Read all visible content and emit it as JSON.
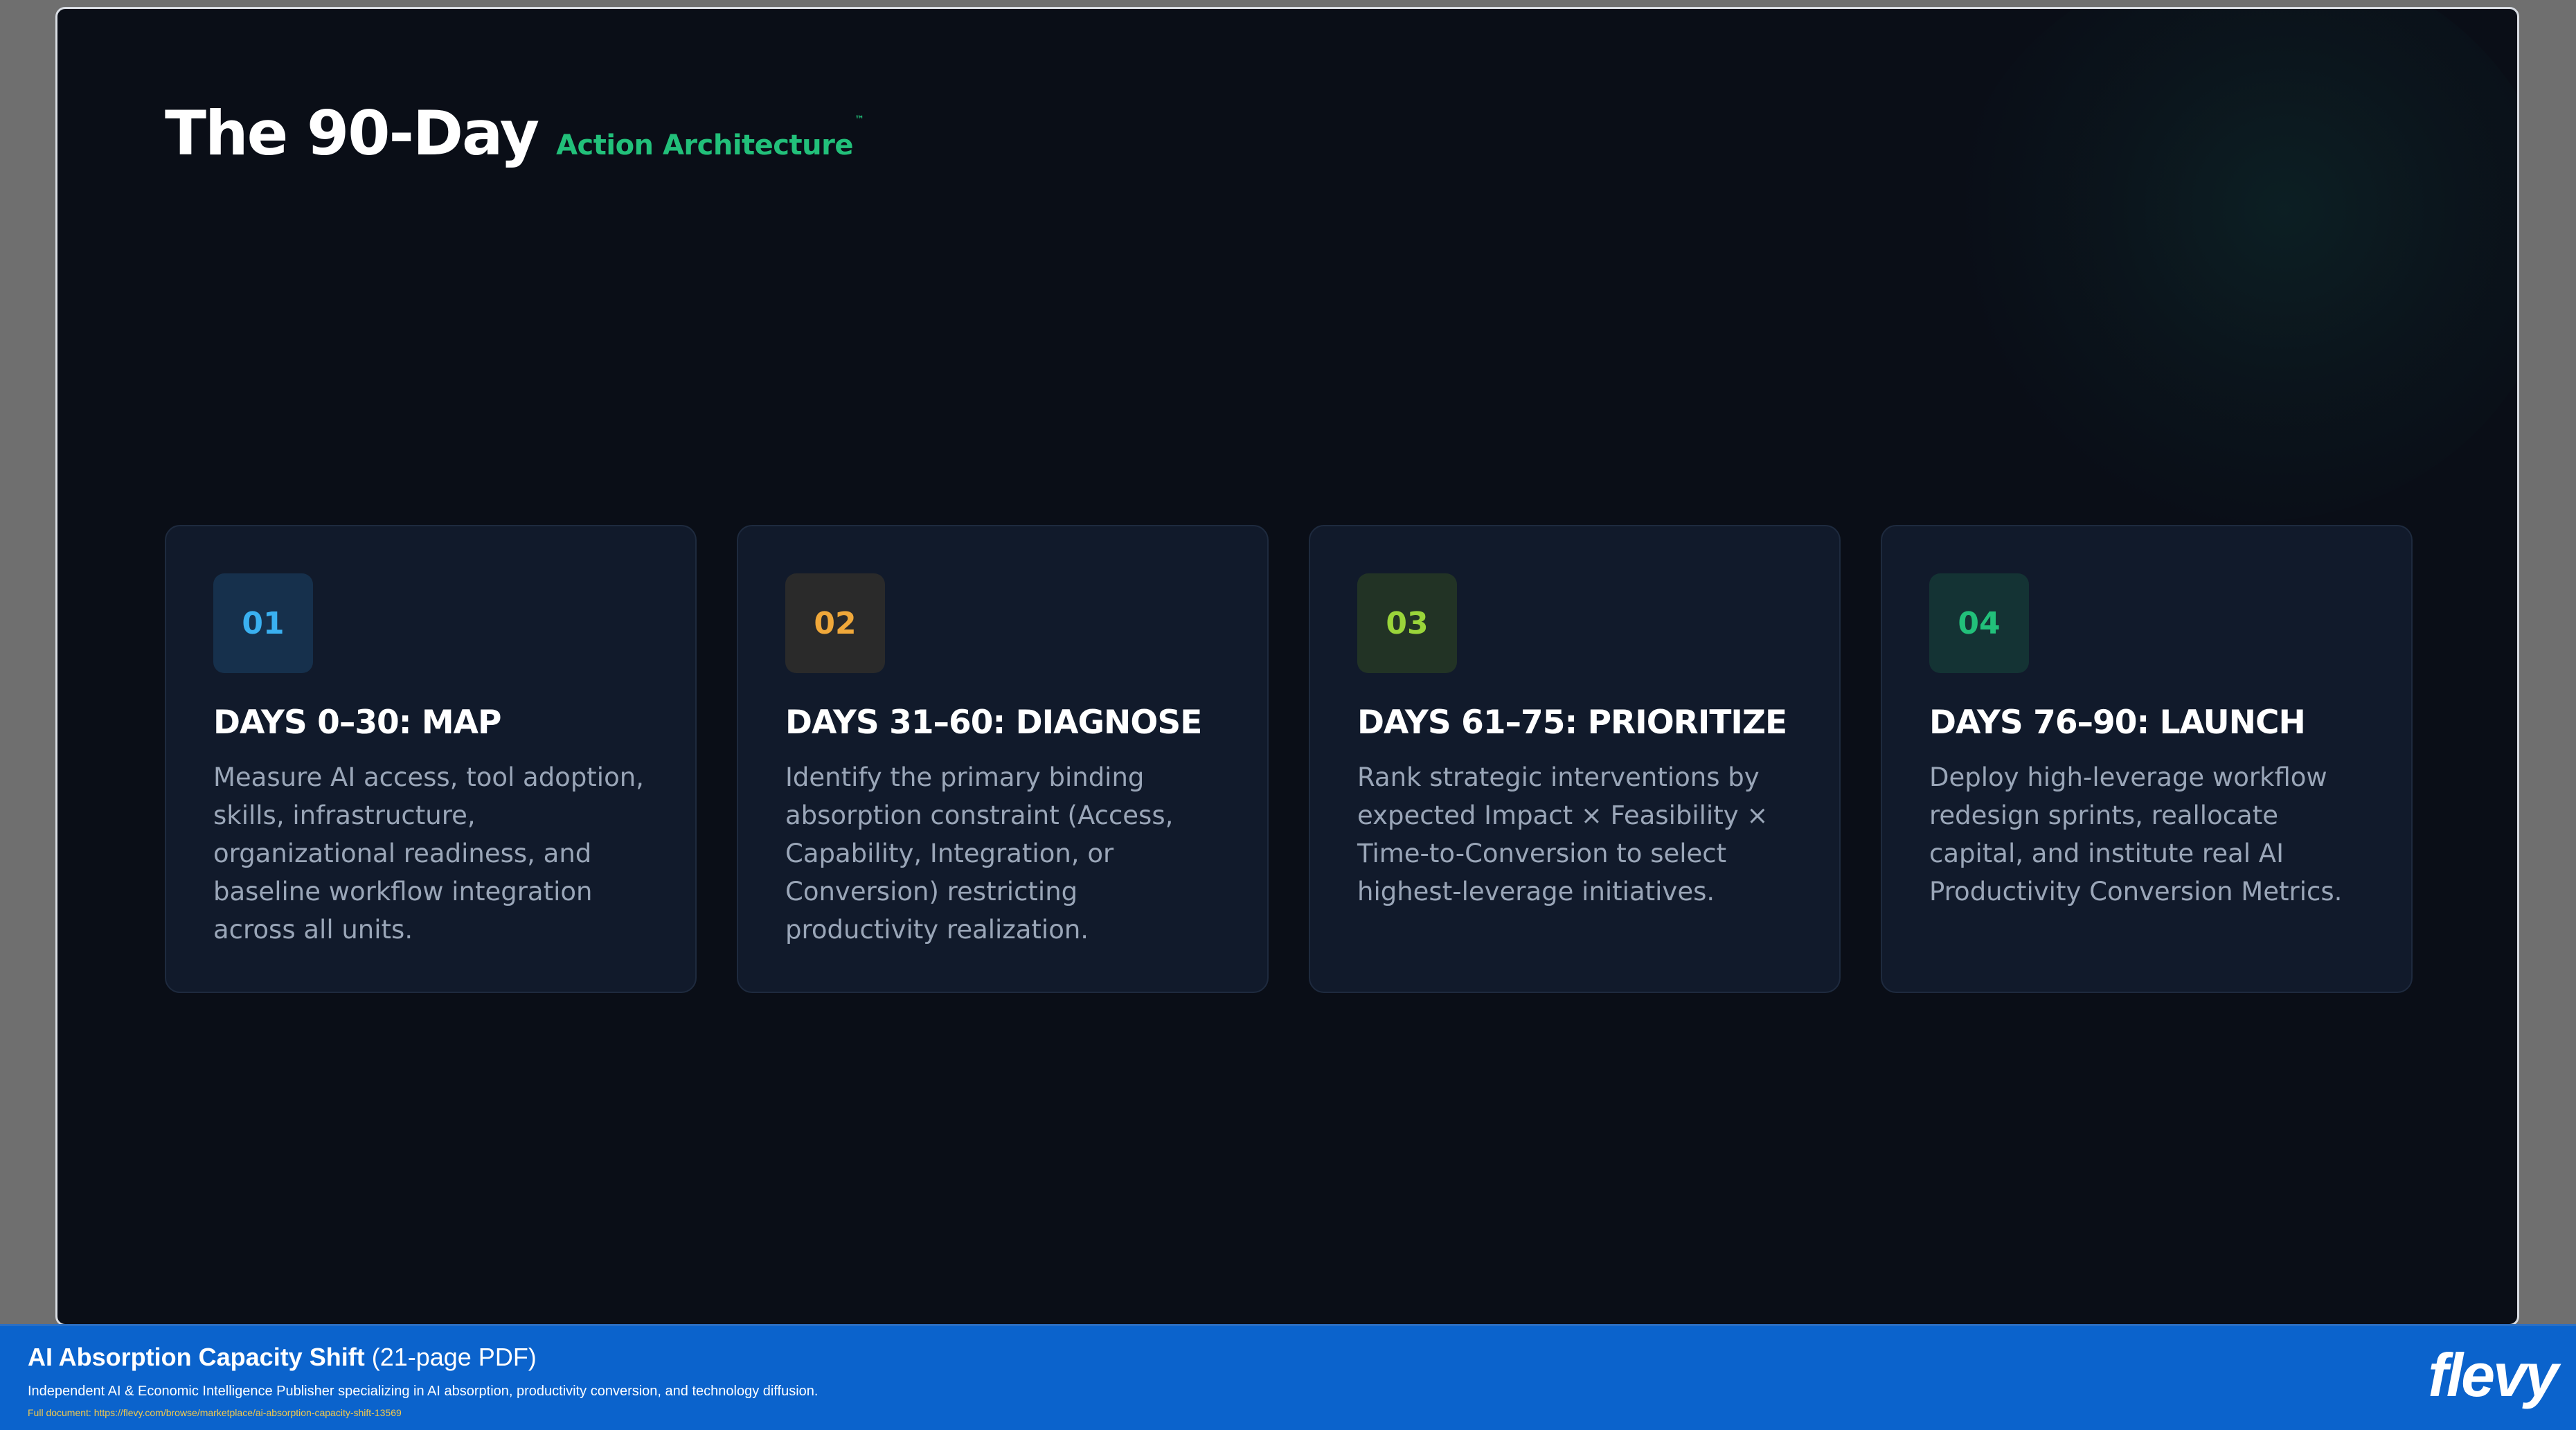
{
  "slide": {
    "title_main": "The 90-Day",
    "title_sub": "Action Architecture",
    "title_tm": "™",
    "cards": [
      {
        "number": "01",
        "number_color": "#3ab0f0",
        "badge_bg": "#16304c",
        "title": "DAYS 0–30: MAP",
        "body": "Measure AI access, tool adoption, skills, infrastructure, organizational readiness, and baseline workflow integration across all units."
      },
      {
        "number": "02",
        "number_color": "#f0a83a",
        "badge_bg": "#2a2a2a",
        "title": "DAYS 31–60: DIAGNOSE",
        "body": "Identify the primary binding absorption constraint (Access, Capability, Integration, or Conversion) restricting productivity realization."
      },
      {
        "number": "03",
        "number_color": "#9ad53a",
        "badge_bg": "#223325",
        "title": "DAYS 61–75: PRIORITIZE",
        "body": "Rank strategic interventions by expected Impact × Feasibility × Time-to-Conversion to select highest-leverage initiatives."
      },
      {
        "number": "04",
        "number_color": "#22c07a",
        "badge_bg": "#143334",
        "title": "DAYS 76–90: LAUNCH",
        "body": "Deploy high-leverage workflow redesign sprints, reallocate capital, and institute real AI Productivity Conversion Metrics."
      }
    ]
  },
  "footer": {
    "doc_title": "AI Absorption Capacity Shift",
    "doc_pages": "(21-page PDF)",
    "description": "Independent AI & Economic Intelligence Publisher specializing in AI absorption, productivity conversion, and technology diffusion.",
    "link_label": "Full document:",
    "link_url": "https://flevy.com/browse/marketplace/ai-absorption-capacity-shift-13569",
    "logo": "flevy"
  }
}
